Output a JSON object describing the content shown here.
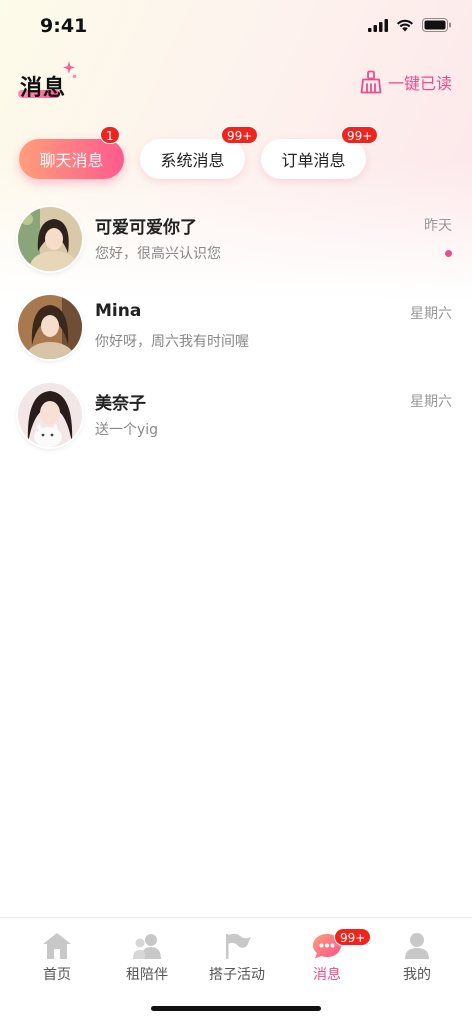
{
  "status_bar": {
    "time": "9:41"
  },
  "header": {
    "title": "消息",
    "mark_all_read": "一键已读"
  },
  "tabs": [
    {
      "label": "聊天消息",
      "badge": "1",
      "active": true
    },
    {
      "label": "系统消息",
      "badge": "99+",
      "active": false
    },
    {
      "label": "订单消息",
      "badge": "99+",
      "active": false
    }
  ],
  "chats": [
    {
      "name": "可爱可爱你了",
      "preview": "您好，很高兴认识您",
      "time": "昨天",
      "unread": true
    },
    {
      "name": "Mina",
      "preview": "你好呀，周六我有时间喔",
      "time": "星期六",
      "unread": false
    },
    {
      "name": "美奈子",
      "preview": "送一个yig",
      "time": "星期六",
      "unread": false
    }
  ],
  "bottom_nav": [
    {
      "label": "首页",
      "icon": "home-icon"
    },
    {
      "label": "租陪伴",
      "icon": "people-icon"
    },
    {
      "label": "搭子活动",
      "icon": "flag-icon"
    },
    {
      "label": "消息",
      "icon": "message-bubble-icon",
      "badge": "99+",
      "active": true
    },
    {
      "label": "我的",
      "icon": "person-icon"
    }
  ],
  "colors": {
    "accent": "#ec4c8c",
    "badge": "#f0241c",
    "tab_gradient_start": "#ff9e7a",
    "tab_gradient_end": "#ff5a8e"
  }
}
